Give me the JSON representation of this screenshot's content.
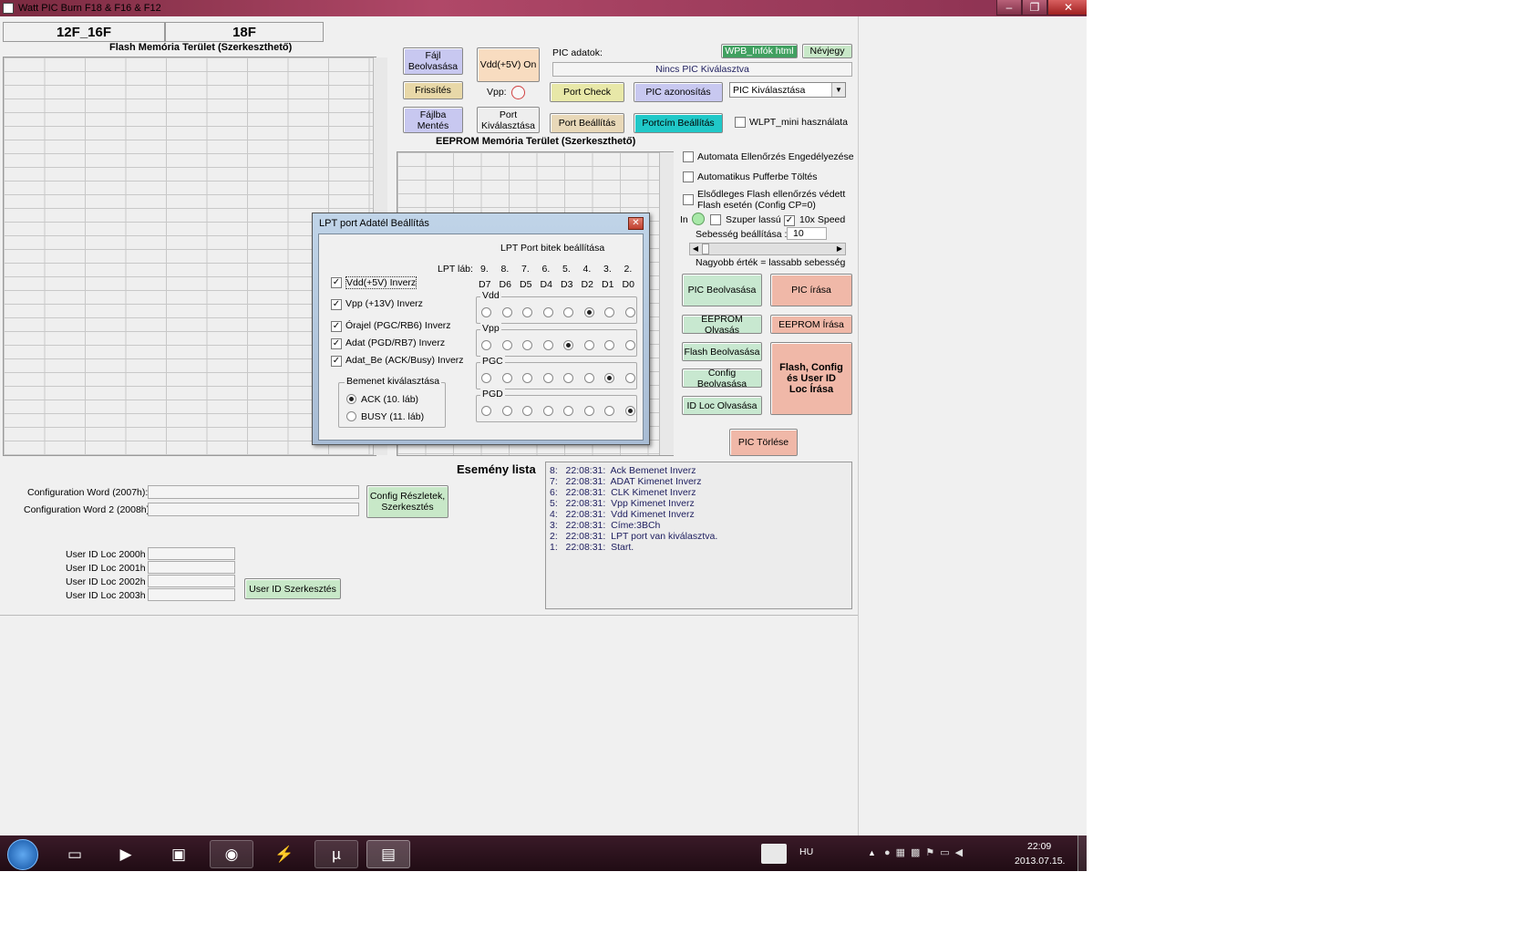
{
  "window": {
    "title": "Watt PIC Burn F18 & F16 & F12",
    "min": "–",
    "max": "❐",
    "close": "✕"
  },
  "tabs": [
    {
      "label": "12F_16F"
    },
    {
      "label": "18F"
    }
  ],
  "flash": {
    "title": "Flash Memória Terület (Szerkeszthető)"
  },
  "eeprom": {
    "title": "EEPROM Memória Terület (Szerkeszthető)"
  },
  "buttons": {
    "file_read": "Fájl Beolvasása",
    "vdd_on": "Vdd(+5V) On",
    "refresh": "Frissítés",
    "vpp_label": "Vpp:",
    "port_check": "Port Check",
    "pic_id": "PIC azonosítás",
    "save_file": "Fájlba Mentés",
    "port_select": "Port Kiválasztása",
    "port_settings": "Port Beállítás",
    "portcim": "Portcím Beállítás",
    "wpb_info": "WPB_Infók html",
    "about": "Névjegy"
  },
  "pic": {
    "label": "PIC adatok:",
    "status": "Nincs PIC Kiválasztva",
    "select_value": "PIC Kiválasztása",
    "wlpt": "WLPT_mini használata"
  },
  "options": {
    "auto_verify": "Automata Ellenőrzés Engedélyezése",
    "auto_buffer": "Automatikus Pufferbe Töltés",
    "primary_flash_1": "Elsődleges Flash ellenőrzés védett",
    "primary_flash_2": "Flash esetén (Config CP=0)",
    "in_label": "In",
    "super_slow": "Szuper lassú",
    "x10": "10x Speed",
    "speed_label": "Sebesség beállítása :",
    "speed_value": "10",
    "speed_hint": "Nagyobb érték = lassabb sebesség"
  },
  "actions": {
    "pic_read": "PIC Beolvasása",
    "pic_write": "PIC írása",
    "eeprom_read": "EEPROM Olvasás",
    "eeprom_write": "EEPROM Írása",
    "flash_read": "Flash Beolvasása",
    "config_read": "Config Beolvasása",
    "idloc_read": "ID Loc Olvasása",
    "flash_config_write": "Flash, Config és User ID Loc Írása",
    "pic_erase": "PIC Törlése"
  },
  "config": {
    "cw1": "Configuration Word (2007h):",
    "cw2": "Configuration Word 2 (2008h):",
    "details_btn": "Config Részletek, Szerkesztés"
  },
  "userid": {
    "l0": "User ID Loc 2000h",
    "l1": "User ID Loc 2001h",
    "l2": "User ID Loc 2002h",
    "l3": "User ID Loc 2003h",
    "btn": "User ID Szerkesztés"
  },
  "events": {
    "title": "Esemény lista",
    "items": [
      "8:   22:08:31:  Ack Bemenet Inverz",
      "7:   22:08:31:  ADAT Kimenet Inverz",
      "6:   22:08:31:  CLK Kimenet Inverz",
      "5:   22:08:31:  Vpp Kimenet Inverz",
      "4:   22:08:31:  Vdd Kimenet Inverz",
      "3:   22:08:31:  Címe:3BCh",
      "2:   22:08:31:  LPT port van kiválasztva.",
      "1:   22:08:31:  Start."
    ]
  },
  "dialog": {
    "title": "LPT port Adatél Beállítás",
    "bits_title": "LPT Port bitek beállítása",
    "lpt_lab": "LPT láb:",
    "pins": [
      "9.",
      "8.",
      "7.",
      "6.",
      "5.",
      "4.",
      "3.",
      "2."
    ],
    "dbits": [
      "D7",
      "D6",
      "D5",
      "D4",
      "D3",
      "D2",
      "D1",
      "D0"
    ],
    "checks": [
      "Vdd(+5V) Inverz",
      "Vpp (+13V) Inverz",
      "Órajel (PGC/RB6) Inverz",
      "Adat (PGD/RB7) Inverz",
      "Adat_Be (ACK/Busy) Inverz"
    ],
    "input_group": "Bemenet kiválasztása",
    "ack": "ACK  (10. láb)",
    "busy": "BUSY (11. láb)",
    "groups": [
      {
        "name": "Vdd",
        "selected": 5
      },
      {
        "name": "Vpp",
        "selected": 4
      },
      {
        "name": "PGC",
        "selected": 6
      },
      {
        "name": "PGD",
        "selected": 7
      }
    ]
  },
  "taskbar": {
    "lang": "HU",
    "time": "22:09",
    "date": "2013.07.15."
  },
  "colors": {
    "green": "#c8e8d0",
    "salmon": "#f0b8a8",
    "lavender": "#c8c8f0",
    "yellow": "#e8e8a8",
    "tan": "#e8d8b8",
    "cyan": "#20c8c8",
    "pale": "#d8f0d8"
  }
}
